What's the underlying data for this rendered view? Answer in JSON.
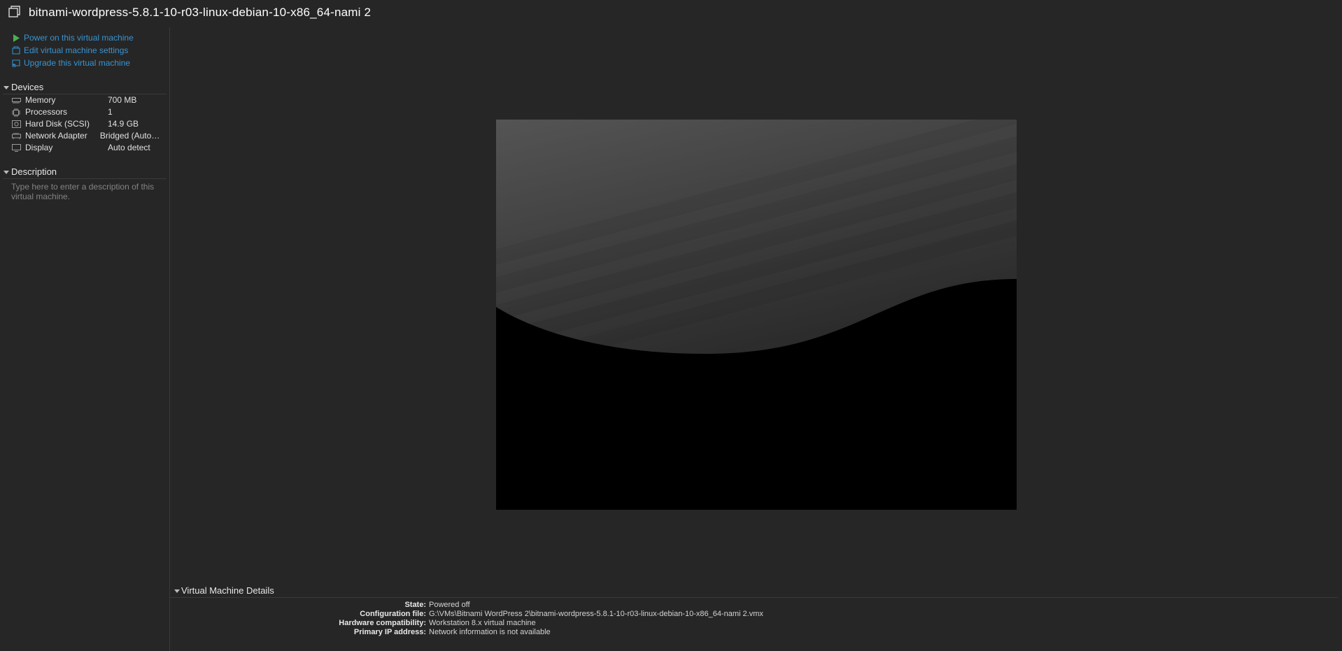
{
  "title": "bitnami-wordpress-5.8.1-10-r03-linux-debian-10-x86_64-nami 2",
  "actions": {
    "power_on": "Power on this virtual machine",
    "edit_settings": "Edit virtual machine settings",
    "upgrade": "Upgrade this virtual machine"
  },
  "sections": {
    "devices": "Devices",
    "description": "Description",
    "details": "Virtual Machine Details"
  },
  "devices": [
    {
      "icon": "memory",
      "label": "Memory",
      "value": "700 MB"
    },
    {
      "icon": "cpu",
      "label": "Processors",
      "value": "1"
    },
    {
      "icon": "disk",
      "label": "Hard Disk (SCSI)",
      "value": "14.9 GB"
    },
    {
      "icon": "network",
      "label": "Network Adapter",
      "value": "Bridged (Automat..."
    },
    {
      "icon": "display",
      "label": "Display",
      "value": "Auto detect"
    }
  ],
  "description_placeholder": "Type here to enter a description of this virtual machine.",
  "details": {
    "state": {
      "k": "State:",
      "v": "Powered off"
    },
    "config_file": {
      "k": "Configuration file:",
      "v": "G:\\VMs\\Bitnami WordPress 2\\bitnami-wordpress-5.8.1-10-r03-linux-debian-10-x86_64-nami 2.vmx"
    },
    "hw_compat": {
      "k": "Hardware compatibility:",
      "v": "Workstation 8.x virtual machine"
    },
    "ip": {
      "k": "Primary IP address:",
      "v": "Network information is not available"
    }
  }
}
